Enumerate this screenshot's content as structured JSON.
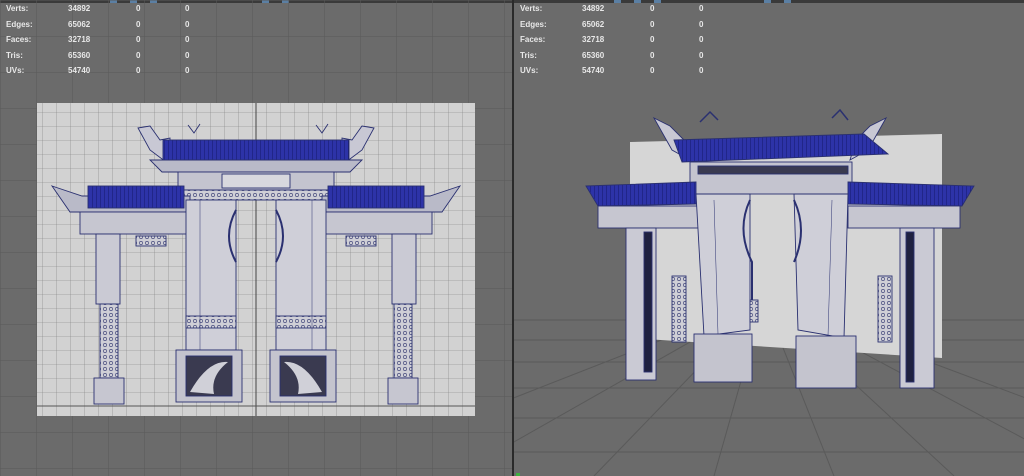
{
  "viewports": [
    {
      "name": "front",
      "stats": [
        {
          "label": "Verts:",
          "v1": "34892",
          "v2": "0",
          "v3": "0"
        },
        {
          "label": "Edges:",
          "v1": "65062",
          "v2": "0",
          "v3": "0"
        },
        {
          "label": "Faces:",
          "v1": "32718",
          "v2": "0",
          "v3": "0"
        },
        {
          "label": "Tris:",
          "v1": "65360",
          "v2": "0",
          "v3": "0"
        },
        {
          "label": "UVs:",
          "v1": "54740",
          "v2": "0",
          "v3": "0"
        }
      ]
    },
    {
      "name": "perspective",
      "stats": [
        {
          "label": "Verts:",
          "v1": "34892",
          "v2": "0",
          "v3": "0"
        },
        {
          "label": "Edges:",
          "v1": "65062",
          "v2": "0",
          "v3": "0"
        },
        {
          "label": "Faces:",
          "v1": "32718",
          "v2": "0",
          "v3": "0"
        },
        {
          "label": "Tris:",
          "v1": "65360",
          "v2": "0",
          "v3": "0"
        },
        {
          "label": "UVs:",
          "v1": "54740",
          "v2": "0",
          "v3": "0"
        }
      ]
    }
  ],
  "colors": {
    "viewport_bg": "#6b6b6b",
    "grid": "#595959",
    "image_plane": "#d2d2d2",
    "roof_tiles": "#2a2fa0",
    "wireframe": "#2a3070",
    "hud_text": "#e8e8e8"
  }
}
